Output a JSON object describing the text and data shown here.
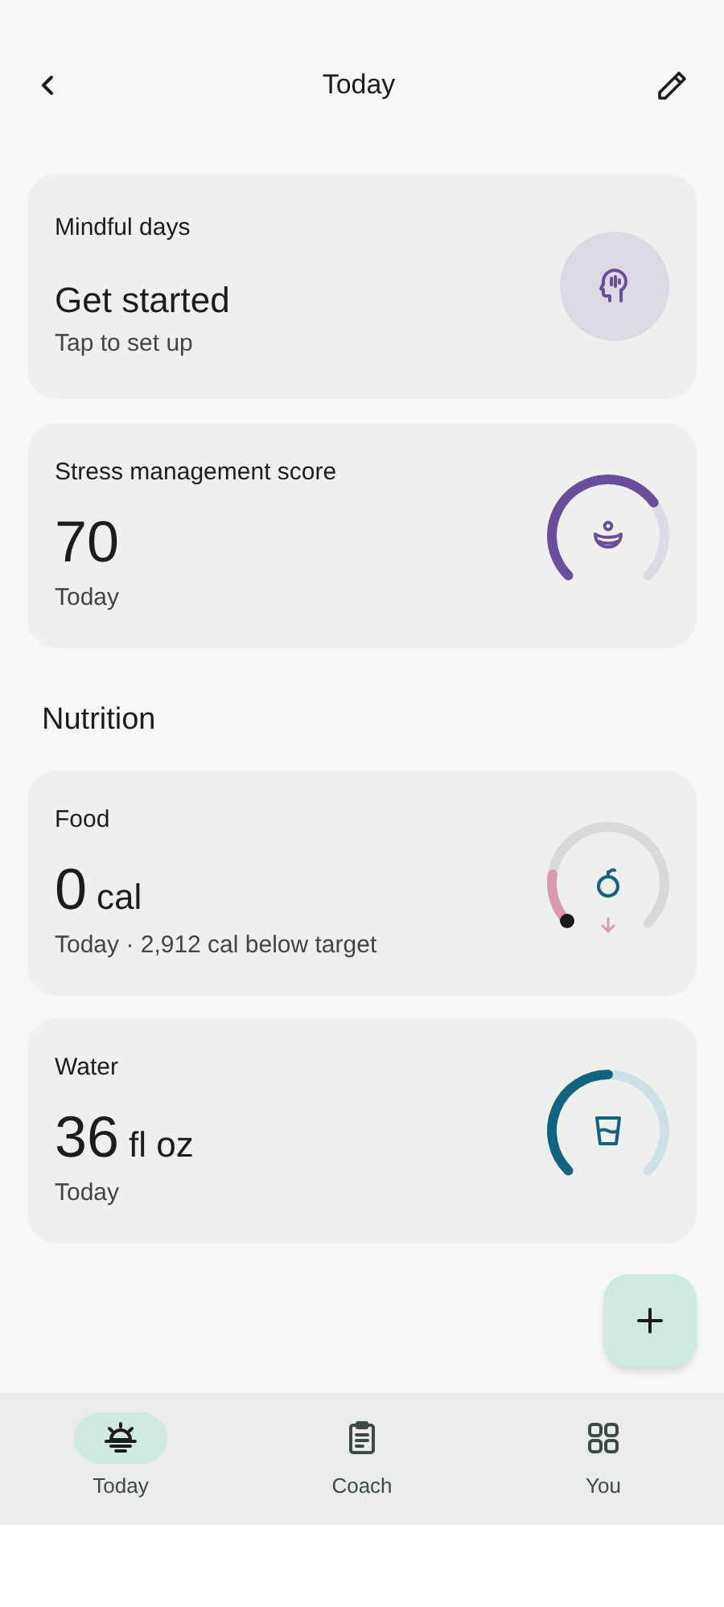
{
  "header": {
    "title": "Today"
  },
  "cards": [
    {
      "kind": "action",
      "title": "Mindful days",
      "value": "Get started",
      "subtitle": "Tap to set up"
    },
    {
      "kind": "gauge",
      "title": "Stress management score",
      "value": "70",
      "subtitle": "Today"
    }
  ],
  "section": {
    "title": "Nutrition"
  },
  "nutrition_cards": [
    {
      "kind": "gauge",
      "title": "Food",
      "value": "0",
      "unit": "cal",
      "subtitle": "Today · 2,912 cal below target"
    },
    {
      "kind": "gauge",
      "title": "Water",
      "value": "36",
      "unit": "fl oz",
      "subtitle": "Today"
    }
  ],
  "nav": [
    {
      "label": "Today",
      "selected": true
    },
    {
      "label": "Coach",
      "selected": false
    },
    {
      "label": "You",
      "selected": false
    }
  ]
}
